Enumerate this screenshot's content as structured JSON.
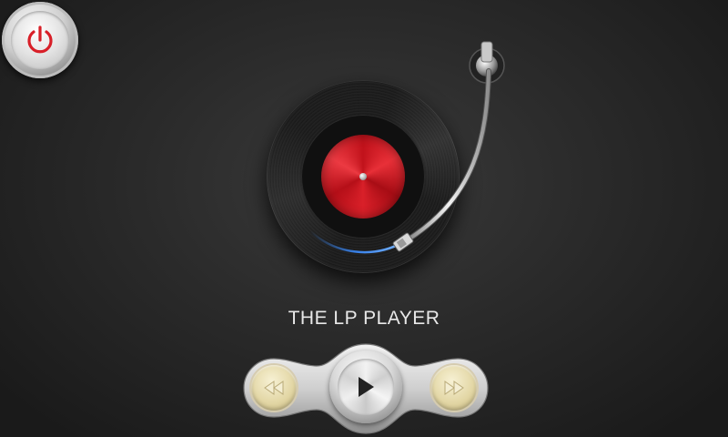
{
  "app": {
    "title": "THE LP PLAYER"
  },
  "colors": {
    "accent_red": "#d81f28",
    "glow_blue": "#3b8cff",
    "background": "#2b2b2b",
    "gold_button": "#e3d7a6"
  },
  "icons": {
    "power": "power-icon",
    "previous": "previous-icon",
    "play": "play-icon",
    "next": "next-icon"
  }
}
